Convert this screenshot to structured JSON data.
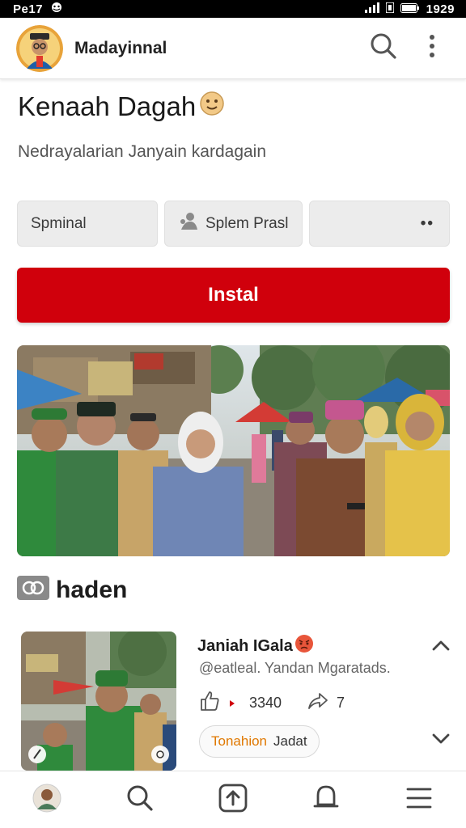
{
  "status_bar": {
    "time": "Pe17",
    "clock": "1929"
  },
  "app_bar": {
    "name": "Madayinnal",
    "icons": [
      "app-logo",
      "search-icon",
      "more-vert-icon"
    ]
  },
  "title": {
    "text": "Kenaah Dagah",
    "emoji": "smiley-emoji"
  },
  "subtitle": "Nedrayalarian Janyain kardagain",
  "chips": [
    {
      "label": "Spminal"
    },
    {
      "label": "Splem Prasl",
      "icon": "person-icon"
    },
    {
      "label": "••"
    }
  ],
  "install_button": "Instal",
  "section": {
    "title": "haden",
    "icon": "link-badge-icon"
  },
  "card": {
    "title": "Janiah IGala",
    "title_emoji": "angry-emoji",
    "subtitle": "@eatleal. Yandan Mgaratads.",
    "likes": "3340",
    "shares": "7",
    "pill_part1": "Tonahion",
    "pill_part2": "Jadat"
  },
  "bottom_nav": [
    "profile-avatar",
    "search-icon",
    "upload-icon",
    "bell-icon",
    "menu-icon"
  ],
  "colors": {
    "primary": "#d0000c",
    "chip_bg": "#ececec",
    "text": "#1f1f1f",
    "muted": "#666666",
    "accent_orange": "#e07800"
  }
}
